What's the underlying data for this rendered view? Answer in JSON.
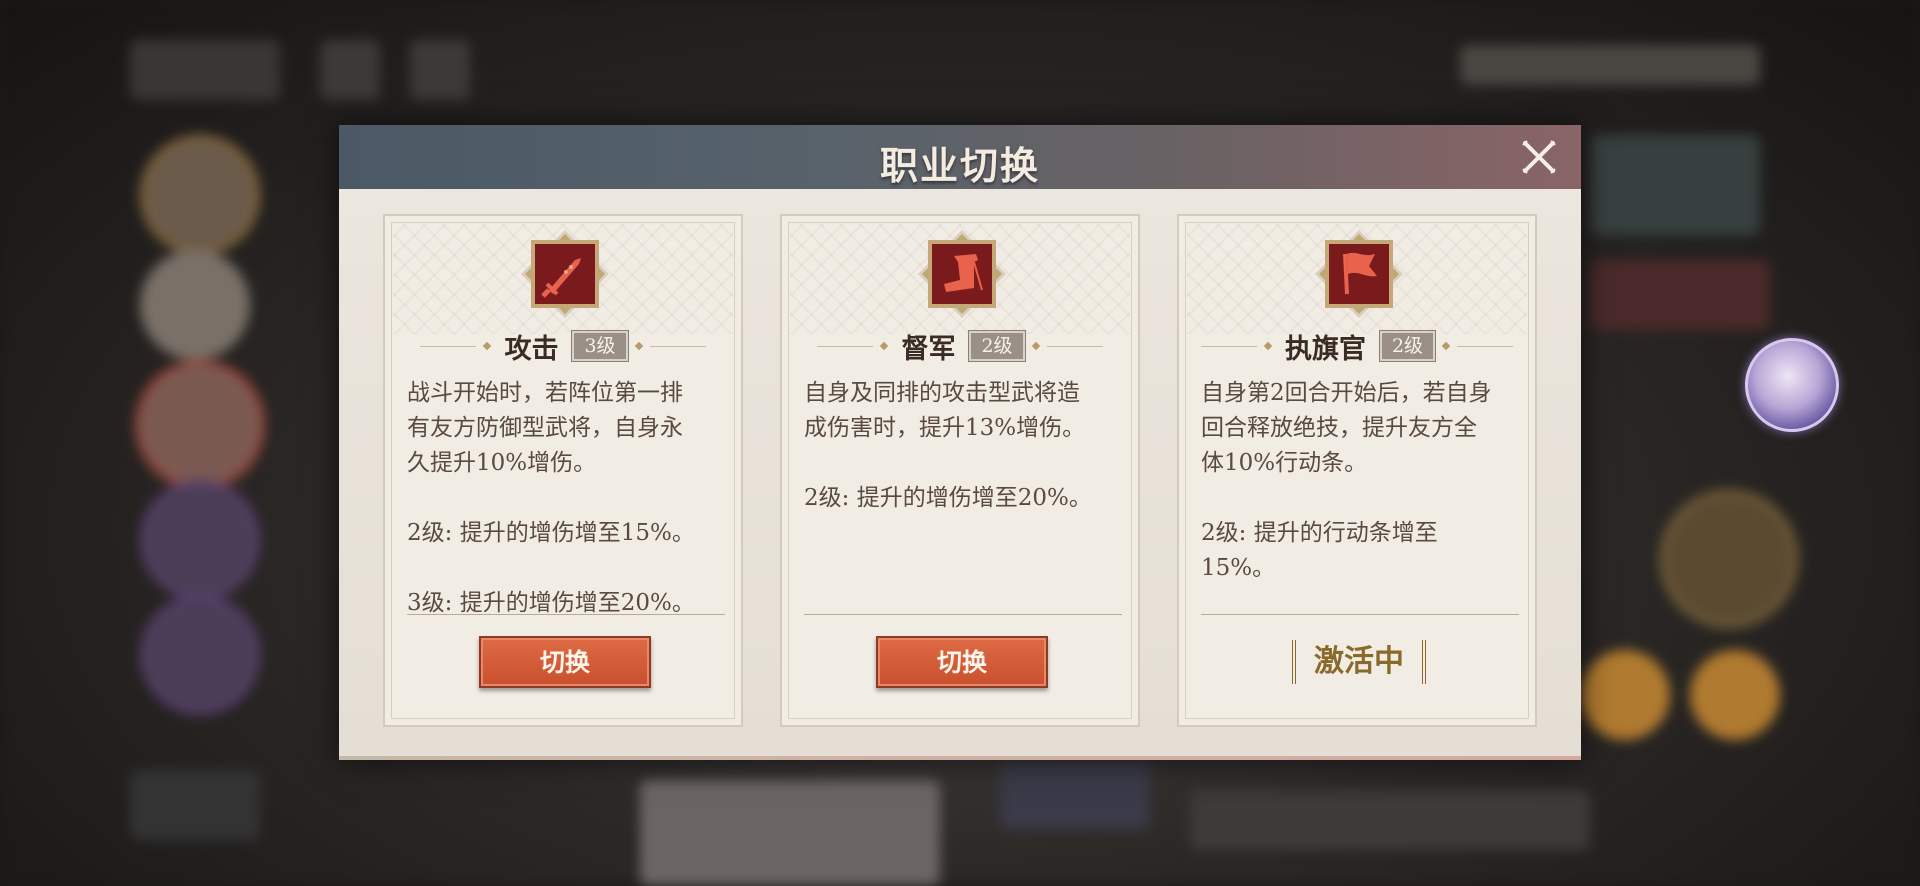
{
  "dialog": {
    "title": "职业切换",
    "close_icon": "close-icon"
  },
  "colors": {
    "header_start": "#4a5965",
    "header_end": "#8a6466",
    "icon_frame": "#7a1c1c",
    "icon_glyph": "#e05a4a",
    "button": "#d45d3a",
    "active": "#8a6a2a"
  },
  "cards": [
    {
      "icon": "sword-icon",
      "name": "攻击",
      "level": "3级",
      "description": "战斗开始时，若阵位第一排\n有友方防御型武将，自身永\n久提升10%增伤。\n\n2级: 提升的增伤增至15%。\n\n3级: 提升的增伤增至20%。",
      "button_label": "切换"
    },
    {
      "icon": "boot-icon",
      "name": "督军",
      "level": "2级",
      "description": "自身及同排的攻击型武将造\n成伤害时，提升13%增伤。\n\n2级: 提升的增伤增至20%。",
      "button_label": "切换"
    },
    {
      "icon": "flag-icon",
      "name": "执旗官",
      "level": "2级",
      "description": "自身第2回合开始后，若自身\n回合释放绝技，提升友方全\n体10%行动条。\n\n2级: 提升的行动条增至\n15%。",
      "status_label": "激活中"
    }
  ]
}
